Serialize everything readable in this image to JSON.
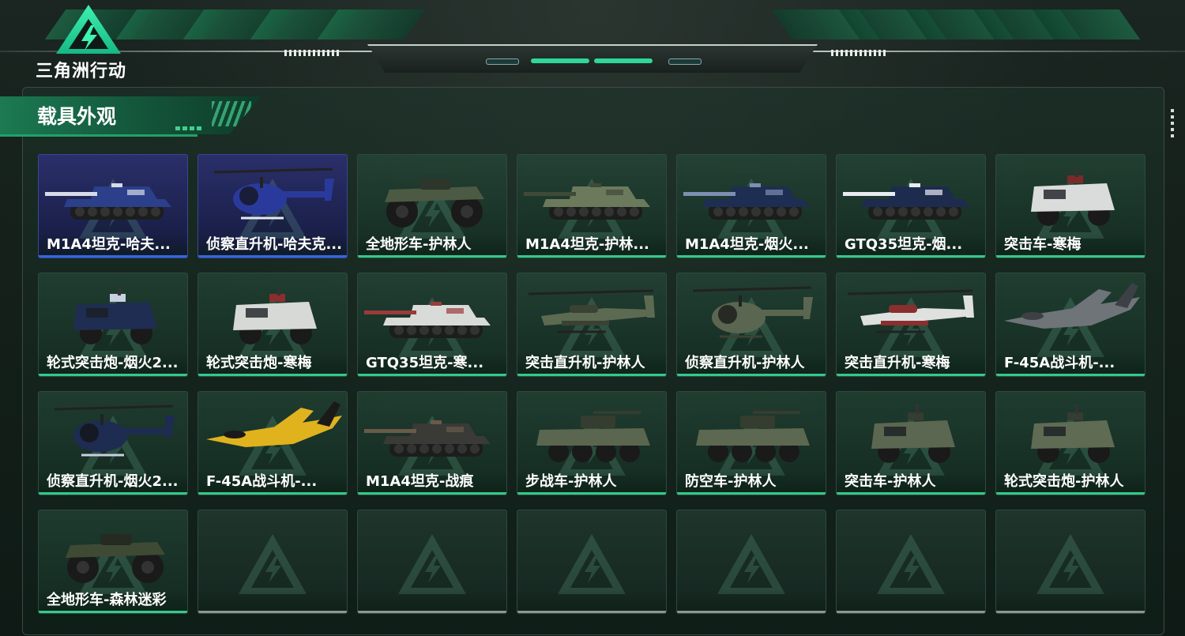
{
  "app": {
    "logo_text": "三角洲行动"
  },
  "panel": {
    "title": "载具外观"
  },
  "colors": {
    "accent": "#34c98a",
    "blue_accent": "#3467e0",
    "empty_bar": "#8e9591"
  },
  "items": [
    {
      "name": "M1A4坦克-哈夫...",
      "kind": "tank",
      "theme": "blue",
      "body": "#2b3f8a",
      "trim": "#d7dbe8"
    },
    {
      "name": "侦察直升机-哈夫克...",
      "kind": "heli_small",
      "theme": "blue",
      "body": "#2a3a9c",
      "trim": "#e6e8f2"
    },
    {
      "name": "全地形车-护林人",
      "kind": "atv",
      "theme": "green",
      "body": "#4c5a44",
      "trim": "#2e352b"
    },
    {
      "name": "M1A4坦克-护林...",
      "kind": "tank",
      "theme": "green",
      "body": "#6c7a5c",
      "trim": "#3f4a37"
    },
    {
      "name": "M1A4坦克-烟火...",
      "kind": "tank",
      "theme": "green",
      "body": "#1e2e52",
      "trim": "#7d8fb2"
    },
    {
      "name": "GTQ35坦克-烟...",
      "kind": "tank",
      "theme": "green",
      "body": "#1d2b4f",
      "trim": "#e8ebf2"
    },
    {
      "name": "突击车-寒梅",
      "kind": "mrap",
      "theme": "green",
      "body": "#d9dcda",
      "trim": "#7a2a2a"
    },
    {
      "name": "轮式突击炮-烟火2...",
      "kind": "mrap",
      "theme": "green",
      "body": "#1f2d52",
      "trim": "#c8cfe2"
    },
    {
      "name": "轮式突击炮-寒梅",
      "kind": "mrap",
      "theme": "green",
      "body": "#d6d9d6",
      "trim": "#8a2e2e"
    },
    {
      "name": "GTQ35坦克-寒...",
      "kind": "tank",
      "theme": "green",
      "body": "#d8dbd8",
      "trim": "#9a3b3b"
    },
    {
      "name": "突击直升机-护林人",
      "kind": "heli_attack",
      "theme": "green",
      "body": "#5d6a52",
      "trim": "#3a4234"
    },
    {
      "name": "侦察直升机-护林人",
      "kind": "heli_small",
      "theme": "green",
      "body": "#5a6650",
      "trim": "#3a4234"
    },
    {
      "name": "突击直升机-寒梅",
      "kind": "heli_attack",
      "theme": "green",
      "body": "#dfe1df",
      "trim": "#8a2e2e"
    },
    {
      "name": "F-45A战斗机-...",
      "kind": "jet",
      "theme": "green",
      "body": "#6f7479",
      "trim": "#3d4145"
    },
    {
      "name": "侦察直升机-烟火2...",
      "kind": "heli_small",
      "theme": "green",
      "body": "#1e2c52",
      "trim": "#c8cfe2"
    },
    {
      "name": "F-45A战斗机-...",
      "kind": "jet",
      "theme": "green",
      "body": "#e0b21e",
      "trim": "#1a1a1a"
    },
    {
      "name": "M1A4坦克-战痕",
      "kind": "tank",
      "theme": "green",
      "body": "#3a3a36",
      "trim": "#6a5a4a"
    },
    {
      "name": "步战车-护林人",
      "kind": "apc",
      "theme": "green",
      "body": "#5a664e",
      "trim": "#353d30"
    },
    {
      "name": "防空车-护林人",
      "kind": "apc",
      "theme": "green",
      "body": "#5c684f",
      "trim": "#353d30"
    },
    {
      "name": "突击车-护林人",
      "kind": "mrap",
      "theme": "green",
      "body": "#5b6750",
      "trim": "#353d30"
    },
    {
      "name": "轮式突击炮-护林人",
      "kind": "mrap",
      "theme": "green",
      "body": "#5f6b53",
      "trim": "#353d30"
    },
    {
      "name": "全地形车-森林迷彩",
      "kind": "atv",
      "theme": "green",
      "body": "#3e4a34",
      "trim": "#252b20"
    },
    {
      "name": "",
      "kind": "empty",
      "theme": "empty"
    },
    {
      "name": "",
      "kind": "empty",
      "theme": "empty"
    },
    {
      "name": "",
      "kind": "empty",
      "theme": "empty"
    },
    {
      "name": "",
      "kind": "empty",
      "theme": "empty"
    },
    {
      "name": "",
      "kind": "empty",
      "theme": "empty"
    },
    {
      "name": "",
      "kind": "empty",
      "theme": "empty"
    }
  ]
}
